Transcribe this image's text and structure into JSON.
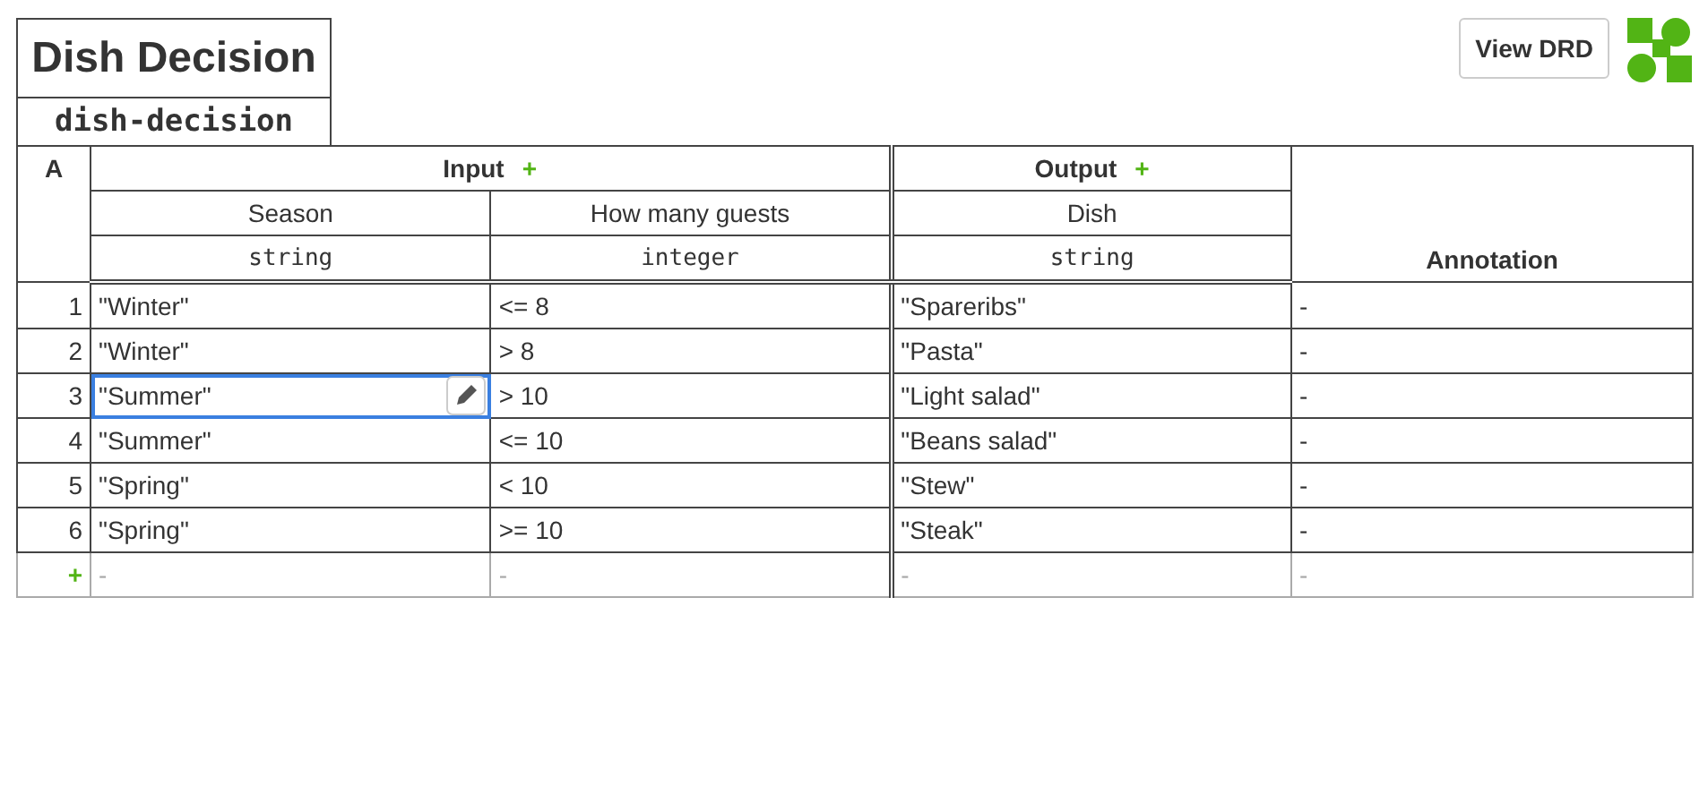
{
  "decision": {
    "name": "Dish Decision",
    "id": "dish-decision"
  },
  "view_drd_button": "View DRD",
  "table": {
    "hit_policy": "A",
    "input_group": {
      "label": "Input",
      "add": "+"
    },
    "output_group": {
      "label": "Output",
      "add": "+"
    },
    "inputs": [
      {
        "label": "Season",
        "type": "string"
      },
      {
        "label": "How many guests",
        "type": "integer"
      }
    ],
    "outputs": [
      {
        "label": "Dish",
        "type": "string"
      }
    ],
    "annotation_label": "Annotation",
    "rules": [
      {
        "number": "1",
        "inputs": [
          {
            "text": "\"Winter\"",
            "selected": false
          },
          {
            "text": "<= 8",
            "selected": false
          }
        ],
        "outputs": [
          {
            "text": "\"Spareribs\"",
            "selected": false
          }
        ],
        "annotation": "-"
      },
      {
        "number": "2",
        "inputs": [
          {
            "text": "\"Winter\"",
            "selected": false
          },
          {
            "text": "> 8",
            "selected": false
          }
        ],
        "outputs": [
          {
            "text": "\"Pasta\"",
            "selected": false
          }
        ],
        "annotation": "-"
      },
      {
        "number": "3",
        "inputs": [
          {
            "text": "\"Summer\"",
            "selected": true
          },
          {
            "text": "> 10",
            "selected": false
          }
        ],
        "outputs": [
          {
            "text": "\"Light salad\"",
            "selected": false
          }
        ],
        "annotation": "-"
      },
      {
        "number": "4",
        "inputs": [
          {
            "text": "\"Summer\"",
            "selected": false
          },
          {
            "text": "<= 10",
            "selected": false
          }
        ],
        "outputs": [
          {
            "text": "\"Beans salad\"",
            "selected": false
          }
        ],
        "annotation": "-"
      },
      {
        "number": "5",
        "inputs": [
          {
            "text": "\"Spring\"",
            "selected": false
          },
          {
            "text": "< 10",
            "selected": false
          }
        ],
        "outputs": [
          {
            "text": "\"Stew\"",
            "selected": false
          }
        ],
        "annotation": "-"
      },
      {
        "number": "6",
        "inputs": [
          {
            "text": "\"Spring\"",
            "selected": false
          },
          {
            "text": ">= 10",
            "selected": false
          }
        ],
        "outputs": [
          {
            "text": "\"Steak\"",
            "selected": false
          }
        ],
        "annotation": "-"
      }
    ],
    "new_rule": {
      "add": "+",
      "cells": [
        "-",
        "-",
        "-",
        "-"
      ]
    }
  }
}
